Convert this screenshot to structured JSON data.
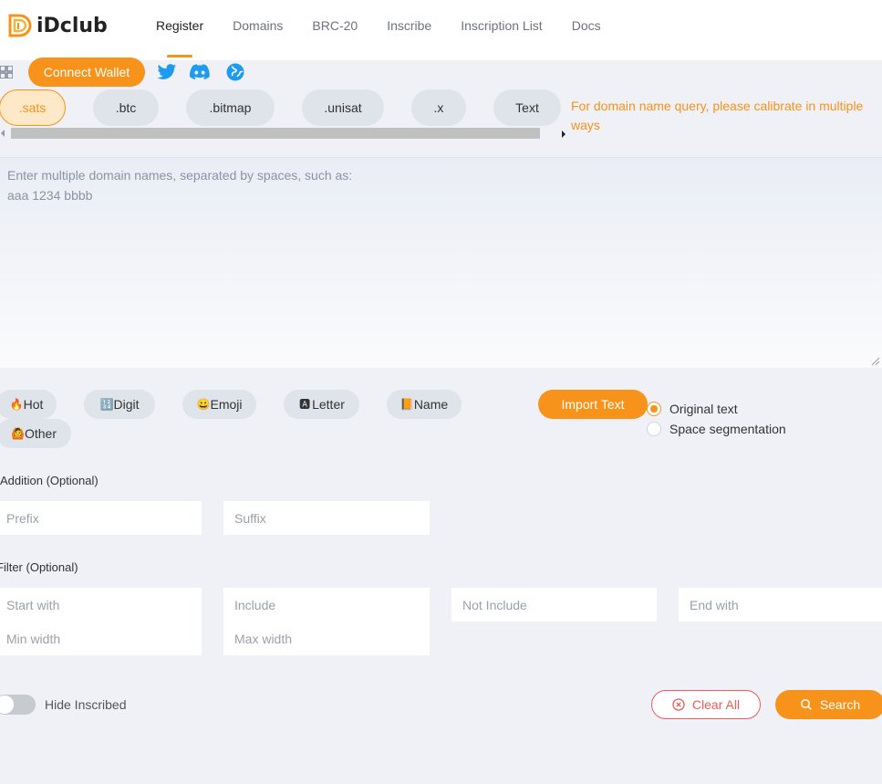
{
  "brand": {
    "name": "iDclub",
    "accent": "#f7931a"
  },
  "nav": {
    "items": [
      {
        "label": "Register"
      },
      {
        "label": "Domains"
      },
      {
        "label": "BRC-20"
      },
      {
        "label": "Inscribe"
      },
      {
        "label": "Inscription List"
      },
      {
        "label": "Docs"
      }
    ]
  },
  "toolbar": {
    "connect_label": "Connect Wallet",
    "icons": [
      "grid-icon",
      "twitter-icon",
      "discord-icon",
      "globe-icon"
    ]
  },
  "tabs": [
    {
      "label": ".sats"
    },
    {
      "label": ".btc"
    },
    {
      "label": ".bitmap"
    },
    {
      "label": ".unisat"
    },
    {
      "label": ".x"
    },
    {
      "label": "Text"
    }
  ],
  "hint": "For domain name query, please calibrate in multiple ways",
  "query": {
    "placeholder": "Enter multiple domain names, separated by spaces, such as:\naaa 1234 bbbb"
  },
  "categories": [
    {
      "label": "Hot",
      "icon": "fire-icon",
      "glyph": "🔥"
    },
    {
      "label": "Digit",
      "icon": "digit-icon",
      "glyph": "🔢"
    },
    {
      "label": "Emoji",
      "icon": "smiley-icon",
      "glyph": "😀"
    },
    {
      "label": "Letter",
      "icon": "letter-icon",
      "glyph": "🅰"
    },
    {
      "label": "Name",
      "icon": "book-icon",
      "glyph": "📙"
    },
    {
      "label": "Other",
      "icon": "person-icon",
      "glyph": "🙆"
    }
  ],
  "import_label": "Import Text",
  "mode": {
    "options": [
      {
        "label": "Original text"
      },
      {
        "label": "Space segmentation"
      }
    ],
    "selected": "Original text"
  },
  "addition": {
    "label": "Addition (Optional)",
    "prefix_placeholder": "Prefix",
    "suffix_placeholder": "Suffix"
  },
  "filter": {
    "label": "Filter (Optional)",
    "start_placeholder": "Start with",
    "include_placeholder": "Include",
    "not_include_placeholder": "Not Include",
    "end_placeholder": "End with",
    "min_placeholder": "Min width",
    "max_placeholder": "Max width"
  },
  "hide_inscribed": {
    "label": "Hide Inscribed",
    "on": false
  },
  "actions": {
    "clear_label": "Clear All",
    "search_label": "Search"
  }
}
